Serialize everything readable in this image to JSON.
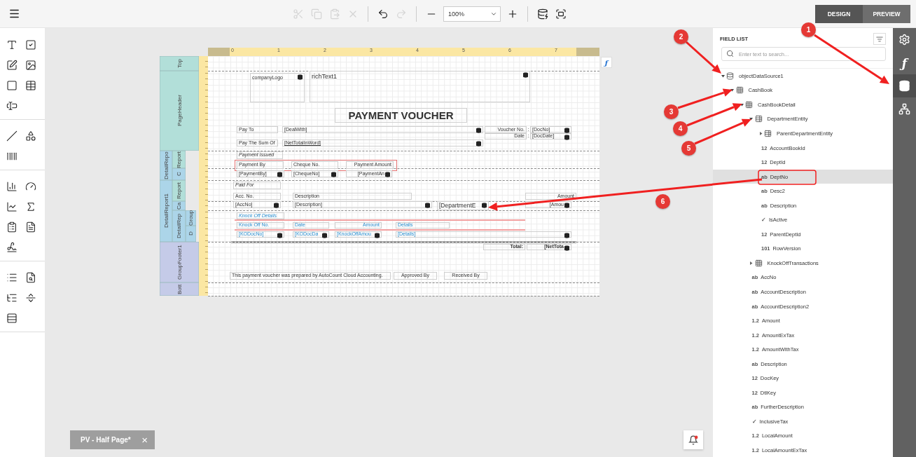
{
  "toolbar": {
    "actions": [
      {
        "kind": "cut",
        "disabled": true
      },
      {
        "kind": "copy",
        "disabled": true
      },
      {
        "kind": "paste",
        "disabled": true
      },
      {
        "kind": "delete",
        "disabled": true
      },
      {
        "kind": "undo",
        "disabled": false
      },
      {
        "kind": "redo",
        "disabled": true
      },
      {
        "kind": "zoom-out",
        "disabled": false
      }
    ],
    "zoom": {
      "value": "100%"
    },
    "actions2": [
      {
        "kind": "zoom-in",
        "disabled": false
      },
      {
        "kind": "validate",
        "disabled": false
      },
      {
        "kind": "fullscreen",
        "disabled": false
      }
    ],
    "modes": [
      {
        "label": "DESIGN",
        "selected": true
      },
      {
        "label": "PREVIEW",
        "selected": false
      }
    ]
  },
  "toolbox": [
    {
      "kind": "text"
    },
    {
      "kind": "checkbox"
    },
    {
      "kind": "edit"
    },
    {
      "kind": "picture"
    },
    {
      "kind": "panel"
    },
    {
      "kind": "table"
    },
    {
      "kind": "label"
    },
    {
      "kind": "line"
    },
    {
      "kind": "shape"
    },
    {
      "kind": "barcode"
    },
    {
      "kind": "chart"
    },
    {
      "kind": "gauge"
    },
    {
      "kind": "sparkline"
    },
    {
      "kind": "summary"
    },
    {
      "kind": "report"
    },
    {
      "kind": "pdf"
    },
    {
      "kind": "signature"
    },
    {
      "kind": "list"
    },
    {
      "kind": "info"
    },
    {
      "kind": "toc"
    },
    {
      "kind": "pagebreak"
    },
    {
      "kind": "rows"
    }
  ],
  "report": {
    "ruler_marks": [
      "0",
      "1",
      "2",
      "3",
      "4",
      "5",
      "6",
      "7"
    ],
    "function_button": "ƒ",
    "bands": [
      {
        "label": "Top",
        "color": "#b2dfd9"
      },
      {
        "label": "PageHeader",
        "color": "#b2dfd9"
      },
      {
        "label": "DetailRepo",
        "color": "#acd5e9"
      },
      {
        "label": "Report",
        "color": "#b2dfd9"
      },
      {
        "label": "C",
        "color": "#acd5e9"
      },
      {
        "label": "DetailReport1",
        "color": "#acd5e9"
      },
      {
        "label": "Report",
        "color": "#b2dfd9"
      },
      {
        "label": "Ca",
        "color": "#acd5e9"
      },
      {
        "label": "DetailRep",
        "color": "#acd5e9"
      },
      {
        "label": "Group",
        "color": "#acd5e9"
      },
      {
        "label": "D",
        "color": "#acd5e9"
      },
      {
        "label": "GroupFooter1",
        "color": "#c5cbe8"
      },
      {
        "label": "Bott",
        "color": "#c5cbe8"
      }
    ],
    "controls": [
      {
        "text": "companyLogo",
        "kind": "picture",
        "bound": true
      },
      {
        "text": "richText1",
        "kind": "richtext",
        "bound": true
      },
      {
        "text": "PAYMENT VOUCHER",
        "kind": "title",
        "bound": false
      },
      {
        "text": "Pay To",
        "kind": "label",
        "bound": false
      },
      {
        "text": "[DealWith]",
        "kind": "field",
        "bound": true
      },
      {
        "text": "Voucher No.",
        "kind": "label-right",
        "bound": false
      },
      {
        "text": ":",
        "kind": "colon",
        "bound": false
      },
      {
        "text": "[DocNo]",
        "kind": "field",
        "bound": true
      },
      {
        "text": "Date",
        "kind": "label-right",
        "bound": false
      },
      {
        "text": ":",
        "kind": "colon",
        "bound": false
      },
      {
        "text": "[DocDate]",
        "kind": "field",
        "bound": true
      },
      {
        "text": "Pay The Sum Of",
        "kind": "label",
        "bound": false
      },
      {
        "text": "[NetTotalInWord]",
        "kind": "underlined",
        "bound": true
      },
      {
        "text": "Payment Issued",
        "kind": "section",
        "bound": false
      },
      {
        "text": "Payment By",
        "kind": "label",
        "bound": false
      },
      {
        "text": "Cheque No.",
        "kind": "label",
        "bound": false
      },
      {
        "text": "Payment Amount",
        "kind": "label-right",
        "bound": false
      },
      {
        "text": "[PaymentBy]",
        "kind": "field",
        "bound": true
      },
      {
        "text": "[ChequeNo]",
        "kind": "field",
        "bound": true
      },
      {
        "text": "[PaymentAn",
        "kind": "field-right",
        "bound": true
      },
      {
        "text": "Paid For",
        "kind": "section",
        "bound": false
      },
      {
        "text": "Acc. No.",
        "kind": "label",
        "bound": false
      },
      {
        "text": "Description",
        "kind": "label",
        "bound": false
      },
      {
        "text": "Amount",
        "kind": "label-right",
        "bound": false
      },
      {
        "text": "[AccNo]",
        "kind": "field",
        "bound": true
      },
      {
        "text": "[Description]",
        "kind": "field",
        "bound": true
      },
      {
        "text": "[DepartmentE",
        "kind": "big-field",
        "bound": true
      },
      {
        "text": "[Amou",
        "kind": "field-right",
        "bound": true
      },
      {
        "text": "Knock Off Details",
        "kind": "link-section",
        "bound": false
      },
      {
        "text": "Knock Off No.",
        "kind": "link-label",
        "bound": false
      },
      {
        "text": "Date",
        "kind": "link-label",
        "bound": false
      },
      {
        "text": "Amount",
        "kind": "link-label-right",
        "bound": false
      },
      {
        "text": "Details",
        "kind": "link-label",
        "bound": false
      },
      {
        "text": "[KODocNo]",
        "kind": "link-field",
        "bound": true
      },
      {
        "text": "[KODocDa",
        "kind": "link-field",
        "bound": true
      },
      {
        "text": "[KnockOffAmou",
        "kind": "link-field",
        "bound": true
      },
      {
        "text": "[Details]",
        "kind": "link-field",
        "bound": true
      },
      {
        "text": "Total:",
        "kind": "total",
        "bound": false
      },
      {
        "text": "[NetTota",
        "kind": "total",
        "bound": true
      },
      {
        "text": "This payment voucher was prepared by AutoCount Cloud Accounting.",
        "kind": "note",
        "bound": false
      },
      {
        "text": "Approved By",
        "kind": "label-center",
        "bound": false
      },
      {
        "text": "Received By",
        "kind": "label-center",
        "bound": false
      }
    ]
  },
  "document_tab": {
    "title": "PV - Half Page*",
    "close": "×"
  },
  "field_list": {
    "title": "FIELD LIST",
    "search": {
      "placeholder": "Enter text to search..."
    },
    "tree": [
      {
        "name": "objectDataSource1",
        "kind": "datasource",
        "expanded": true,
        "selected": false,
        "children": [
          {
            "name": "CashBook",
            "kind": "table",
            "expanded": true,
            "selected": false,
            "children": [
              {
                "name": "CashBookDetail",
                "kind": "table",
                "expanded": true,
                "selected": false,
                "children": [
                  {
                    "name": "DepartmentEntity",
                    "kind": "entity",
                    "expanded": true,
                    "selected": false,
                    "children": [
                      {
                        "name": "ParentDepartmentEntity",
                        "kind": "entity",
                        "expanded": false,
                        "selected": false
                      },
                      {
                        "name": "AccountBookId",
                        "kind": "field",
                        "type_label": "12",
                        "selected": false
                      },
                      {
                        "name": "DeptId",
                        "kind": "field",
                        "type_label": "12",
                        "selected": false
                      },
                      {
                        "name": "DeptNo",
                        "kind": "field",
                        "type_label": "ab",
                        "selected": true
                      },
                      {
                        "name": "Desc2",
                        "kind": "field",
                        "type_label": "ab",
                        "selected": false
                      },
                      {
                        "name": "Description",
                        "kind": "field",
                        "type_label": "ab",
                        "selected": false
                      },
                      {
                        "name": "IsActive",
                        "kind": "field",
                        "type_label": "✓",
                        "selected": false
                      },
                      {
                        "name": "ParentDeptId",
                        "kind": "field",
                        "type_label": "12",
                        "selected": false
                      },
                      {
                        "name": "RowVersion",
                        "kind": "field",
                        "type_label": "101",
                        "selected": false
                      }
                    ]
                  },
                  {
                    "name": "KnockOffTransactions",
                    "kind": "table",
                    "expanded": false,
                    "selected": false
                  },
                  {
                    "name": "AccNo",
                    "kind": "field",
                    "type_label": "ab",
                    "selected": false
                  },
                  {
                    "name": "AccountDescription",
                    "kind": "field",
                    "type_label": "ab",
                    "selected": false
                  },
                  {
                    "name": "AccountDescription2",
                    "kind": "field",
                    "type_label": "ab",
                    "selected": false
                  },
                  {
                    "name": "Amount",
                    "kind": "field",
                    "type_label": "1.2",
                    "selected": false
                  },
                  {
                    "name": "AmountExTax",
                    "kind": "field",
                    "type_label": "1.2",
                    "selected": false
                  },
                  {
                    "name": "AmountWithTax",
                    "kind": "field",
                    "type_label": "1.2",
                    "selected": false
                  },
                  {
                    "name": "Description",
                    "kind": "field",
                    "type_label": "ab",
                    "selected": false
                  },
                  {
                    "name": "DocKey",
                    "kind": "field",
                    "type_label": "12",
                    "selected": false
                  },
                  {
                    "name": "DtlKey",
                    "kind": "field",
                    "type_label": "12",
                    "selected": false
                  },
                  {
                    "name": "FurtherDescription",
                    "kind": "field",
                    "type_label": "ab",
                    "selected": false
                  },
                  {
                    "name": "InclusiveTax",
                    "kind": "field",
                    "type_label": "✓",
                    "selected": false
                  },
                  {
                    "name": "LocalAmount",
                    "kind": "field",
                    "type_label": "1.2",
                    "selected": false
                  },
                  {
                    "name": "LocalAmountExTax",
                    "kind": "field",
                    "type_label": "1.2",
                    "selected": false
                  }
                ]
              }
            ]
          }
        ]
      }
    ]
  },
  "side_tabs": [
    {
      "kind": "settings",
      "selected": false
    },
    {
      "kind": "function",
      "glyph": "ƒ",
      "selected": false
    },
    {
      "kind": "database",
      "selected": true
    },
    {
      "kind": "hierarchy",
      "selected": false
    }
  ],
  "annotations": [
    {
      "number": "1"
    },
    {
      "number": "2"
    },
    {
      "number": "3"
    },
    {
      "number": "4"
    },
    {
      "number": "5"
    },
    {
      "number": "6"
    }
  ]
}
